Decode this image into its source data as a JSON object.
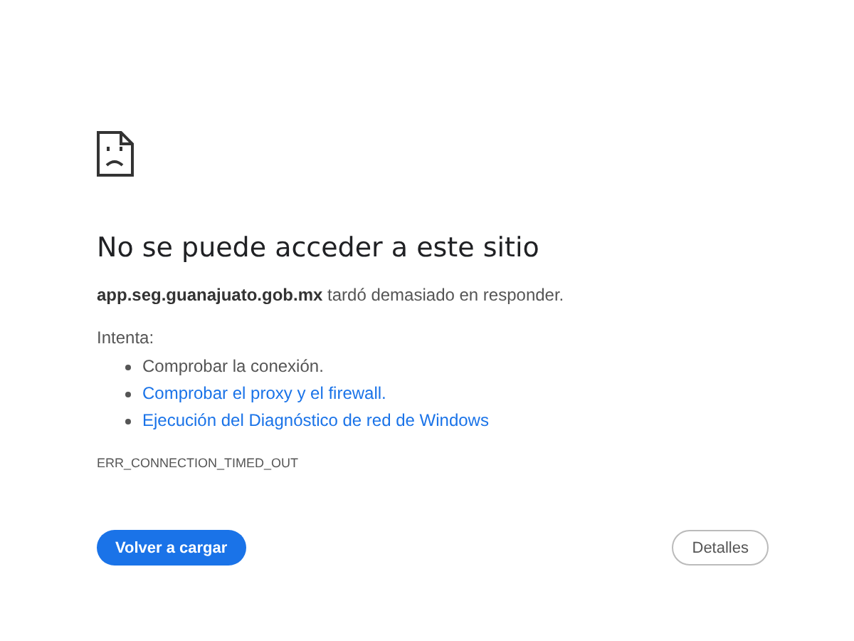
{
  "heading": "No se puede acceder a este sitio",
  "message": "**app.seg.guanajuato.gob.mx** tardó demasiado en responder.",
  "suggestions_label": "Intenta:",
  "suggestions": [
    {
      "kind": "text",
      "text": "Comprobar la conexión."
    },
    {
      "kind": "link",
      "text": "Comprobar el proxy y el firewall."
    },
    {
      "kind": "link",
      "text": "Ejecución del Diagnóstico de red de Windows"
    }
  ],
  "error_code": "ERR_CONNECTION_TIMED_OUT",
  "buttons": [
    {
      "kind": "primary",
      "label": "Volver a cargar"
    },
    {
      "kind": "secondary",
      "label": "Detalles"
    }
  ]
}
